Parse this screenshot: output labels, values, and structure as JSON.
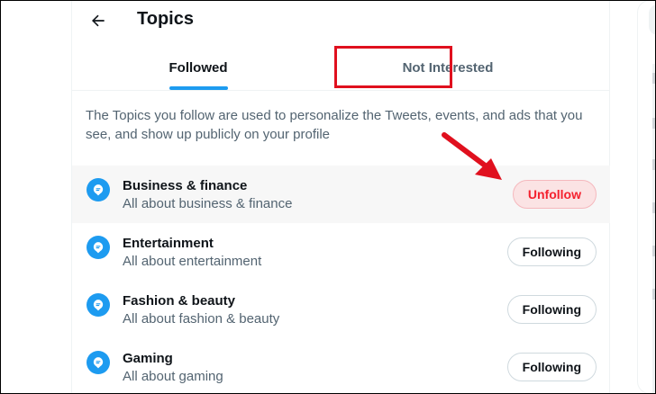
{
  "header": {
    "title": "Topics"
  },
  "tabs": [
    {
      "label": "Followed",
      "active": true
    },
    {
      "label": "Not Interested",
      "active": false
    }
  ],
  "description": "The Topics you follow are used to personalize the Tweets, events, and ads that you see, and show up publicly on your profile",
  "topics": [
    {
      "name": "Business & finance",
      "subtitle": "All about business & finance",
      "button": "Unfollow"
    },
    {
      "name": "Entertainment",
      "subtitle": "All about entertainment",
      "button": "Following"
    },
    {
      "name": "Fashion & beauty",
      "subtitle": "All about fashion & beauty",
      "button": "Following"
    },
    {
      "name": "Gaming",
      "subtitle": "All about gaming",
      "button": "Following"
    }
  ],
  "colors": {
    "accent": "#1d9bf0",
    "annotation": "#e0101e",
    "unfollow_text": "#f4212e",
    "unfollow_bg": "#fbe3e4"
  },
  "icons": {
    "back": "arrow-left-icon",
    "topic": "topic-bubble-icon"
  }
}
